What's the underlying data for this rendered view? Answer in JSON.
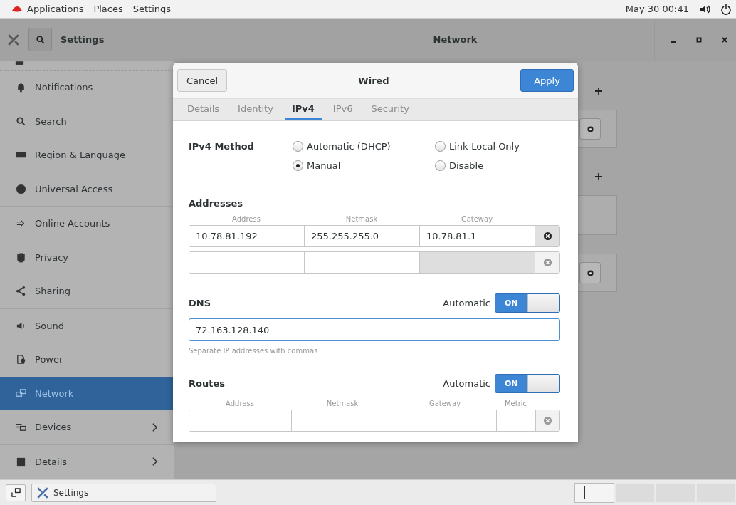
{
  "top_bar": {
    "menus": [
      "Applications",
      "Places",
      "Settings"
    ],
    "clock": "May 30 00:41"
  },
  "header": {
    "app_title": "Settings",
    "page_title": "Network"
  },
  "sidebar": {
    "groups": [
      [
        {
          "label": "Notifications",
          "selected": false,
          "chevron": false
        },
        {
          "label": "Search",
          "selected": false,
          "chevron": false
        },
        {
          "label": "Region & Language",
          "selected": false,
          "chevron": false
        },
        {
          "label": "Universal Access",
          "selected": false,
          "chevron": false
        }
      ],
      [
        {
          "label": "Online Accounts",
          "selected": false,
          "chevron": false
        },
        {
          "label": "Privacy",
          "selected": false,
          "chevron": false
        },
        {
          "label": "Sharing",
          "selected": false,
          "chevron": false
        }
      ],
      [
        {
          "label": "Sound",
          "selected": false,
          "chevron": false
        },
        {
          "label": "Power",
          "selected": false,
          "chevron": false
        },
        {
          "label": "Network",
          "selected": true,
          "chevron": false
        },
        {
          "label": "Devices",
          "selected": false,
          "chevron": true
        }
      ],
      [
        {
          "label": "Details",
          "selected": false,
          "chevron": true
        }
      ]
    ]
  },
  "dialog": {
    "title": "Wired",
    "cancel": "Cancel",
    "apply": "Apply",
    "tabs": [
      {
        "label": "Details",
        "selected": false
      },
      {
        "label": "Identity",
        "selected": false
      },
      {
        "label": "IPv4",
        "selected": true
      },
      {
        "label": "IPv6",
        "selected": false
      },
      {
        "label": "Security",
        "selected": false
      }
    ],
    "method_label": "IPv4 Method",
    "methods": [
      {
        "label": "Automatic (DHCP)",
        "selected": false
      },
      {
        "label": "Link-Local Only",
        "selected": false
      },
      {
        "label": "Manual",
        "selected": true
      },
      {
        "label": "Disable",
        "selected": false
      }
    ],
    "addresses": {
      "title": "Addresses",
      "columns": [
        "Address",
        "Netmask",
        "Gateway"
      ],
      "rows": [
        {
          "cells": [
            {
              "value": "10.78.81.192",
              "disabled": false
            },
            {
              "value": "255.255.255.0",
              "disabled": false
            },
            {
              "value": "10.78.81.1",
              "disabled": false
            }
          ],
          "removable": true
        },
        {
          "cells": [
            {
              "disabled": false
            },
            {
              "disabled": false
            },
            {
              "disabled": true
            }
          ],
          "removable": false
        }
      ]
    },
    "dns": {
      "title": "DNS",
      "auto_label": "Automatic",
      "switch": {
        "on": true,
        "label": "ON"
      },
      "value": "72.163.128.140",
      "hint": "Separate IP addresses with commas"
    },
    "routes": {
      "title": "Routes",
      "auto_label": "Automatic",
      "switch": {
        "on": true,
        "label": "ON"
      },
      "columns": [
        "Address",
        "Netmask",
        "Gateway",
        "Metric"
      ]
    }
  },
  "taskbar": {
    "task": "Settings"
  }
}
